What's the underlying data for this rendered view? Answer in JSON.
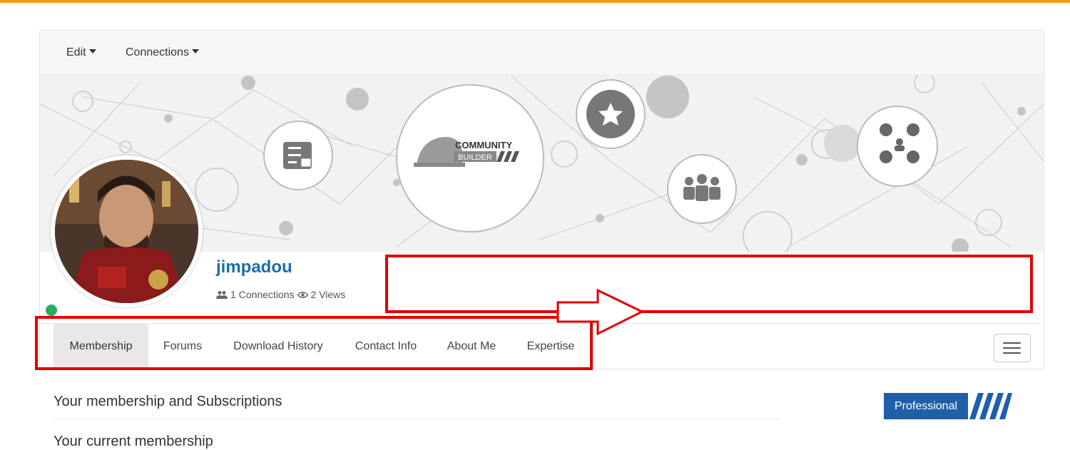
{
  "menubar": {
    "edit_label": "Edit",
    "connections_label": "Connections"
  },
  "banner": {
    "logo_line1": "COMMUNITY",
    "logo_line2": "BUILDER"
  },
  "profile": {
    "username": "jimpadou",
    "connections_text": "1 Connections",
    "views_text": "2 Views",
    "online_color": "#27ae60"
  },
  "tabs": [
    {
      "label": "Membership",
      "active": true
    },
    {
      "label": "Forums"
    },
    {
      "label": "Download History"
    },
    {
      "label": "Contact Info"
    },
    {
      "label": "About Me"
    },
    {
      "label": "Expertise"
    }
  ],
  "content": {
    "section_title": "Your membership and Subscriptions",
    "section_subtitle": "Your current membership"
  },
  "badge": {
    "label": "Professional"
  },
  "colors": {
    "accent": "#f39c12",
    "link": "#1a6ea8",
    "annotation": "#e00000",
    "badge": "#1f5fa8"
  }
}
